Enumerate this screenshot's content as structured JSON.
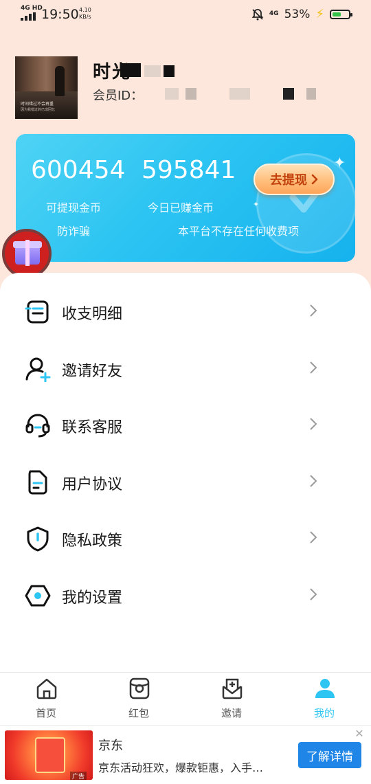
{
  "status_bar": {
    "network": "4G HD",
    "time": "19:50",
    "speed_value": "4.10",
    "speed_unit": "KB/s",
    "mobile": "4G",
    "battery_percent": "53%",
    "battery_level": 0.53
  },
  "profile": {
    "nickname": "时光",
    "member_id_label": "会员ID：",
    "avatar_caption": "时间错过不会再重",
    "avatar_caption_small": "因为我错过的已成回忆"
  },
  "coin_card": {
    "withdrawable_coins": "600454",
    "withdrawable_label": "可提现金币",
    "today_coins": "595841",
    "today_label": "今日已赚金币",
    "withdraw_button": "去提现",
    "notice_left": "防诈骗",
    "notice_right": "本平台不存在任何收费项"
  },
  "menu": {
    "items": [
      {
        "label": "收支明细",
        "icon": "ledger-icon"
      },
      {
        "label": "邀请好友",
        "icon": "invite-user-icon"
      },
      {
        "label": "联系客服",
        "icon": "headset-icon"
      },
      {
        "label": "用户协议",
        "icon": "document-icon"
      },
      {
        "label": "隐私政策",
        "icon": "shield-icon"
      },
      {
        "label": "我的设置",
        "icon": "settings-icon"
      }
    ]
  },
  "bottom_nav": {
    "items": [
      {
        "label": "首页",
        "icon": "home-icon"
      },
      {
        "label": "红包",
        "icon": "red-packet-icon"
      },
      {
        "label": "邀请",
        "icon": "invite-icon"
      },
      {
        "label": "我的",
        "icon": "profile-icon"
      }
    ],
    "active_color": "#2ec5f3"
  },
  "ad": {
    "title": "京东",
    "description": "京东活动狂欢，爆款钜惠，入手…",
    "button": "了解详情",
    "tag": "广告",
    "close": "✕"
  }
}
